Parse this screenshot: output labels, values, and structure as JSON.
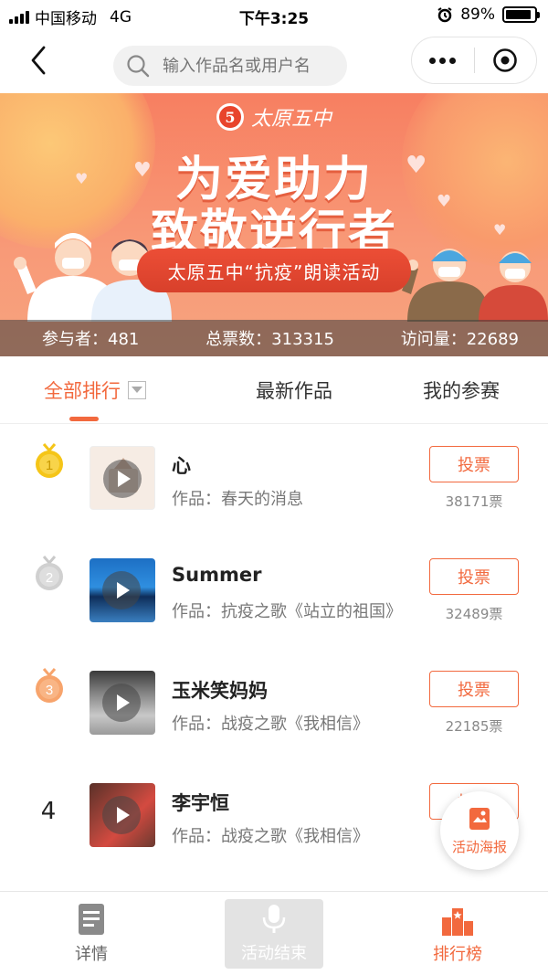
{
  "status_bar": {
    "carrier": "中国移动",
    "network": "4G",
    "time": "下午3:25",
    "battery": "89%",
    "battery_level": 0.89
  },
  "navbar": {
    "search_placeholder": "输入作品名或用户名"
  },
  "banner": {
    "school_logo_text": "太原五中",
    "logo_mark": "5",
    "headline_line1": "为爱助力",
    "headline_line2": "致敬逆行者",
    "ribbon": "太原五中“抗疫”朗读活动",
    "stats": {
      "participants": "参与者：481",
      "total_votes": "总票数：313315",
      "visits": "访问量：22689"
    }
  },
  "tabs": [
    {
      "label": "全部排行"
    },
    {
      "label": "最新作品"
    },
    {
      "label": "我的参赛"
    }
  ],
  "entries": [
    {
      "rank": "1",
      "name": "心",
      "work": "作品：春天的消息",
      "vote_label": "投票",
      "votes": "38171票"
    },
    {
      "rank": "2",
      "name": "Summer",
      "work": "作品：抗疫之歌《站立的祖国》",
      "vote_label": "投票",
      "votes": "32489票"
    },
    {
      "rank": "3",
      "name": "玉米笑妈妈",
      "work": "作品：战疫之歌《我相信》",
      "vote_label": "投票",
      "votes": "22185票"
    },
    {
      "rank": "4",
      "name": "李宇恒",
      "work": "作品：战疫之歌《我相信》",
      "vote_label": "投票",
      "votes": ""
    }
  ],
  "floating_button": {
    "label": "活动海报"
  },
  "bottom_bar": {
    "detail": "详情",
    "ended": "活动结束",
    "ranking": "排行榜"
  },
  "colors": {
    "accent": "#f2693e",
    "gold": "#f5c518",
    "silver": "#c9c9c9",
    "bronze": "#f7a46c"
  }
}
